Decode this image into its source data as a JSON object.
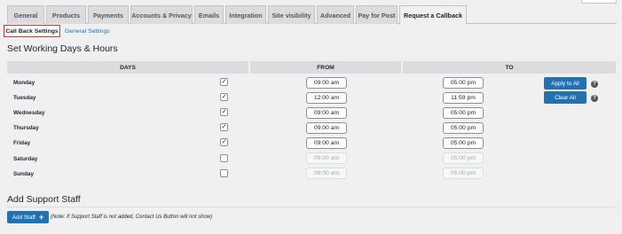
{
  "tabs": [
    "General",
    "Products",
    "Payments",
    "Accounts & Privacy",
    "Emails",
    "Integration",
    "Site visibility",
    "Advanced",
    "Pay for Post",
    "Request a Callback"
  ],
  "subtabs": {
    "active": "Call Back Settings",
    "link": "General Settings"
  },
  "section_working": {
    "title": "Set Working Days & Hours"
  },
  "table": {
    "headers": {
      "days": "DAYS",
      "from": "FROM",
      "to": "TO"
    },
    "rows": [
      {
        "day": "Monday",
        "checked": "✓",
        "from": "09:00 am",
        "to": "05:00 pm"
      },
      {
        "day": "Tuesday",
        "checked": "✓",
        "from": "12:00 am",
        "to": "11:59 pm"
      },
      {
        "day": "Wednesday",
        "checked": "✓",
        "from": "09:00 am",
        "to": "05:00 pm"
      },
      {
        "day": "Thursday",
        "checked": "✓",
        "from": "09:00 am",
        "to": "05:00 pm"
      },
      {
        "day": "Friday",
        "checked": "✓",
        "from": "09:00 am",
        "to": "05:00 pm"
      },
      {
        "day": "Saturday",
        "checked": "",
        "from": "09:00 am",
        "to": "05:00 pm"
      },
      {
        "day": "Sunday",
        "checked": "",
        "from": "09:00 am",
        "to": "05:00 pm"
      }
    ]
  },
  "buttons": {
    "apply_all": "Apply to All",
    "clear_all": "Clear All",
    "help": "?"
  },
  "section_staff": {
    "title": "Add Support Staff",
    "add_button": "Add Staff",
    "add_icon": "+",
    "note": "(Note: If Support Staff is not added, Contact Us Button will not show)"
  },
  "colors": {
    "accent": "#2271b1",
    "highlight": "#d63638",
    "header_bg": "#dcdcde"
  }
}
